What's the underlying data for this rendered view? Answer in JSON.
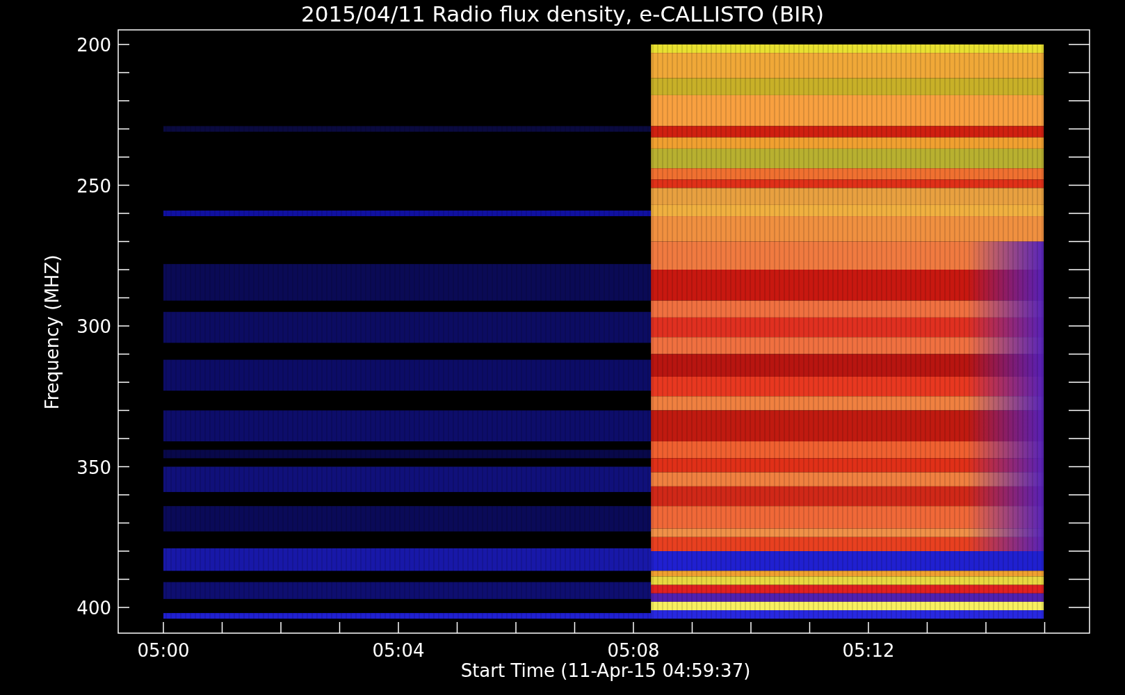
{
  "title": "2015/04/11  Radio flux density, e-CALLISTO (BIR)",
  "plot": {
    "ylabel": "Frequency (MHZ)",
    "xlabel": "Start Time (11-Apr-15 04:59:37)",
    "y_tick_labels": [
      "200",
      "250",
      "300",
      "350",
      "400"
    ],
    "x_tick_labels": [
      "05:00",
      "05:04",
      "05:08",
      "05:12"
    ]
  }
}
